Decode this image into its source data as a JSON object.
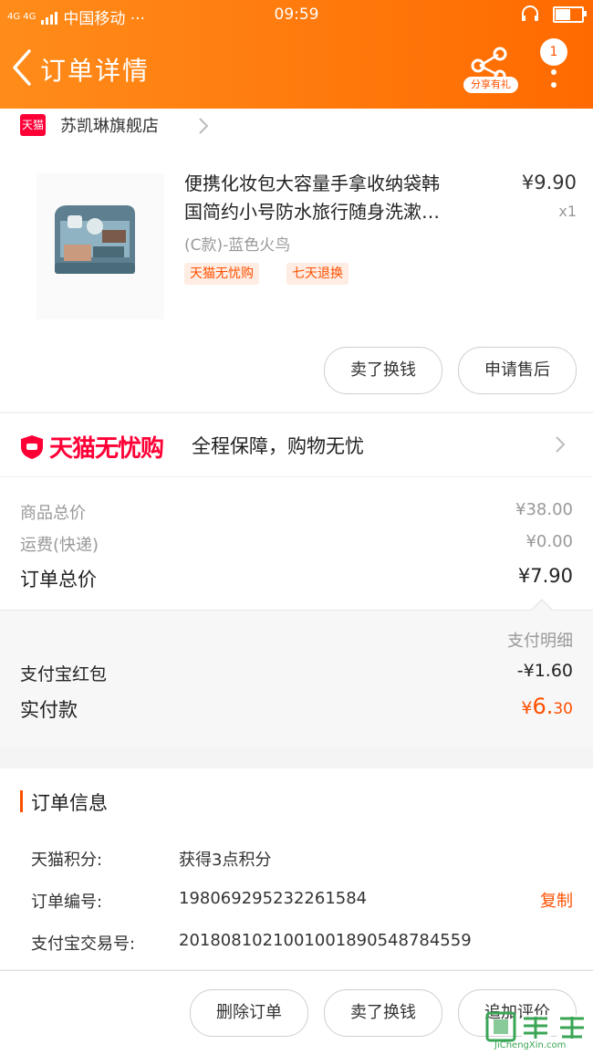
{
  "status_bar": {
    "network": "4G 4G",
    "carrier": "中国移动 ···",
    "time": "09:59"
  },
  "header": {
    "title": "订单详情",
    "share_label": "分享有礼",
    "notification_count": "1"
  },
  "store": {
    "logo_text": "天猫",
    "name": "苏凯琳旗舰店"
  },
  "product": {
    "name_line1": "便携化妆包大容量手拿收纳袋韩",
    "name_line2": "国简约小号防水旅行随身洗漱…",
    "price": "¥9.90",
    "quantity": "x1",
    "sku": "(C款)-蓝色火鸟",
    "tags": [
      "天猫无忧购",
      "七天退换"
    ],
    "actions": [
      "卖了换钱",
      "申请售后"
    ]
  },
  "guarantee": {
    "brand": "天猫无忧购",
    "text": "全程保障，购物无忧"
  },
  "prices": {
    "goods_total_label": "商品总价",
    "goods_total_value": "¥38.00",
    "shipping_label": "运费(快递)",
    "shipping_value": "¥0.00",
    "order_total_label": "订单总价",
    "order_total_value": "¥7.90"
  },
  "payment": {
    "detail_label": "支付明细",
    "redpacket_label": "支付宝红包",
    "redpacket_value": "-¥1.60",
    "paid_label": "实付款",
    "paid_currency": "¥",
    "paid_int": "6.",
    "paid_dec": "30"
  },
  "order_info": {
    "title": "订单信息",
    "points_label": "天猫积分:",
    "points_value": "获得3点积分",
    "order_no_label": "订单编号:",
    "order_no_value": "1980692952322615​84",
    "copy_label": "复制",
    "alipay_no_label": "支付宝交易号:",
    "alipay_no_value": "2018081021001001890548784559"
  },
  "bottom_actions": [
    "删除订单",
    "卖了换钱",
    "追加评价"
  ],
  "watermark": {
    "text": "JiChengXin.com"
  },
  "colors": {
    "header_start": "#ff8c1a",
    "header_end": "#ff6a00",
    "accent": "#ff5000",
    "tmall_red": "#ff0036"
  }
}
